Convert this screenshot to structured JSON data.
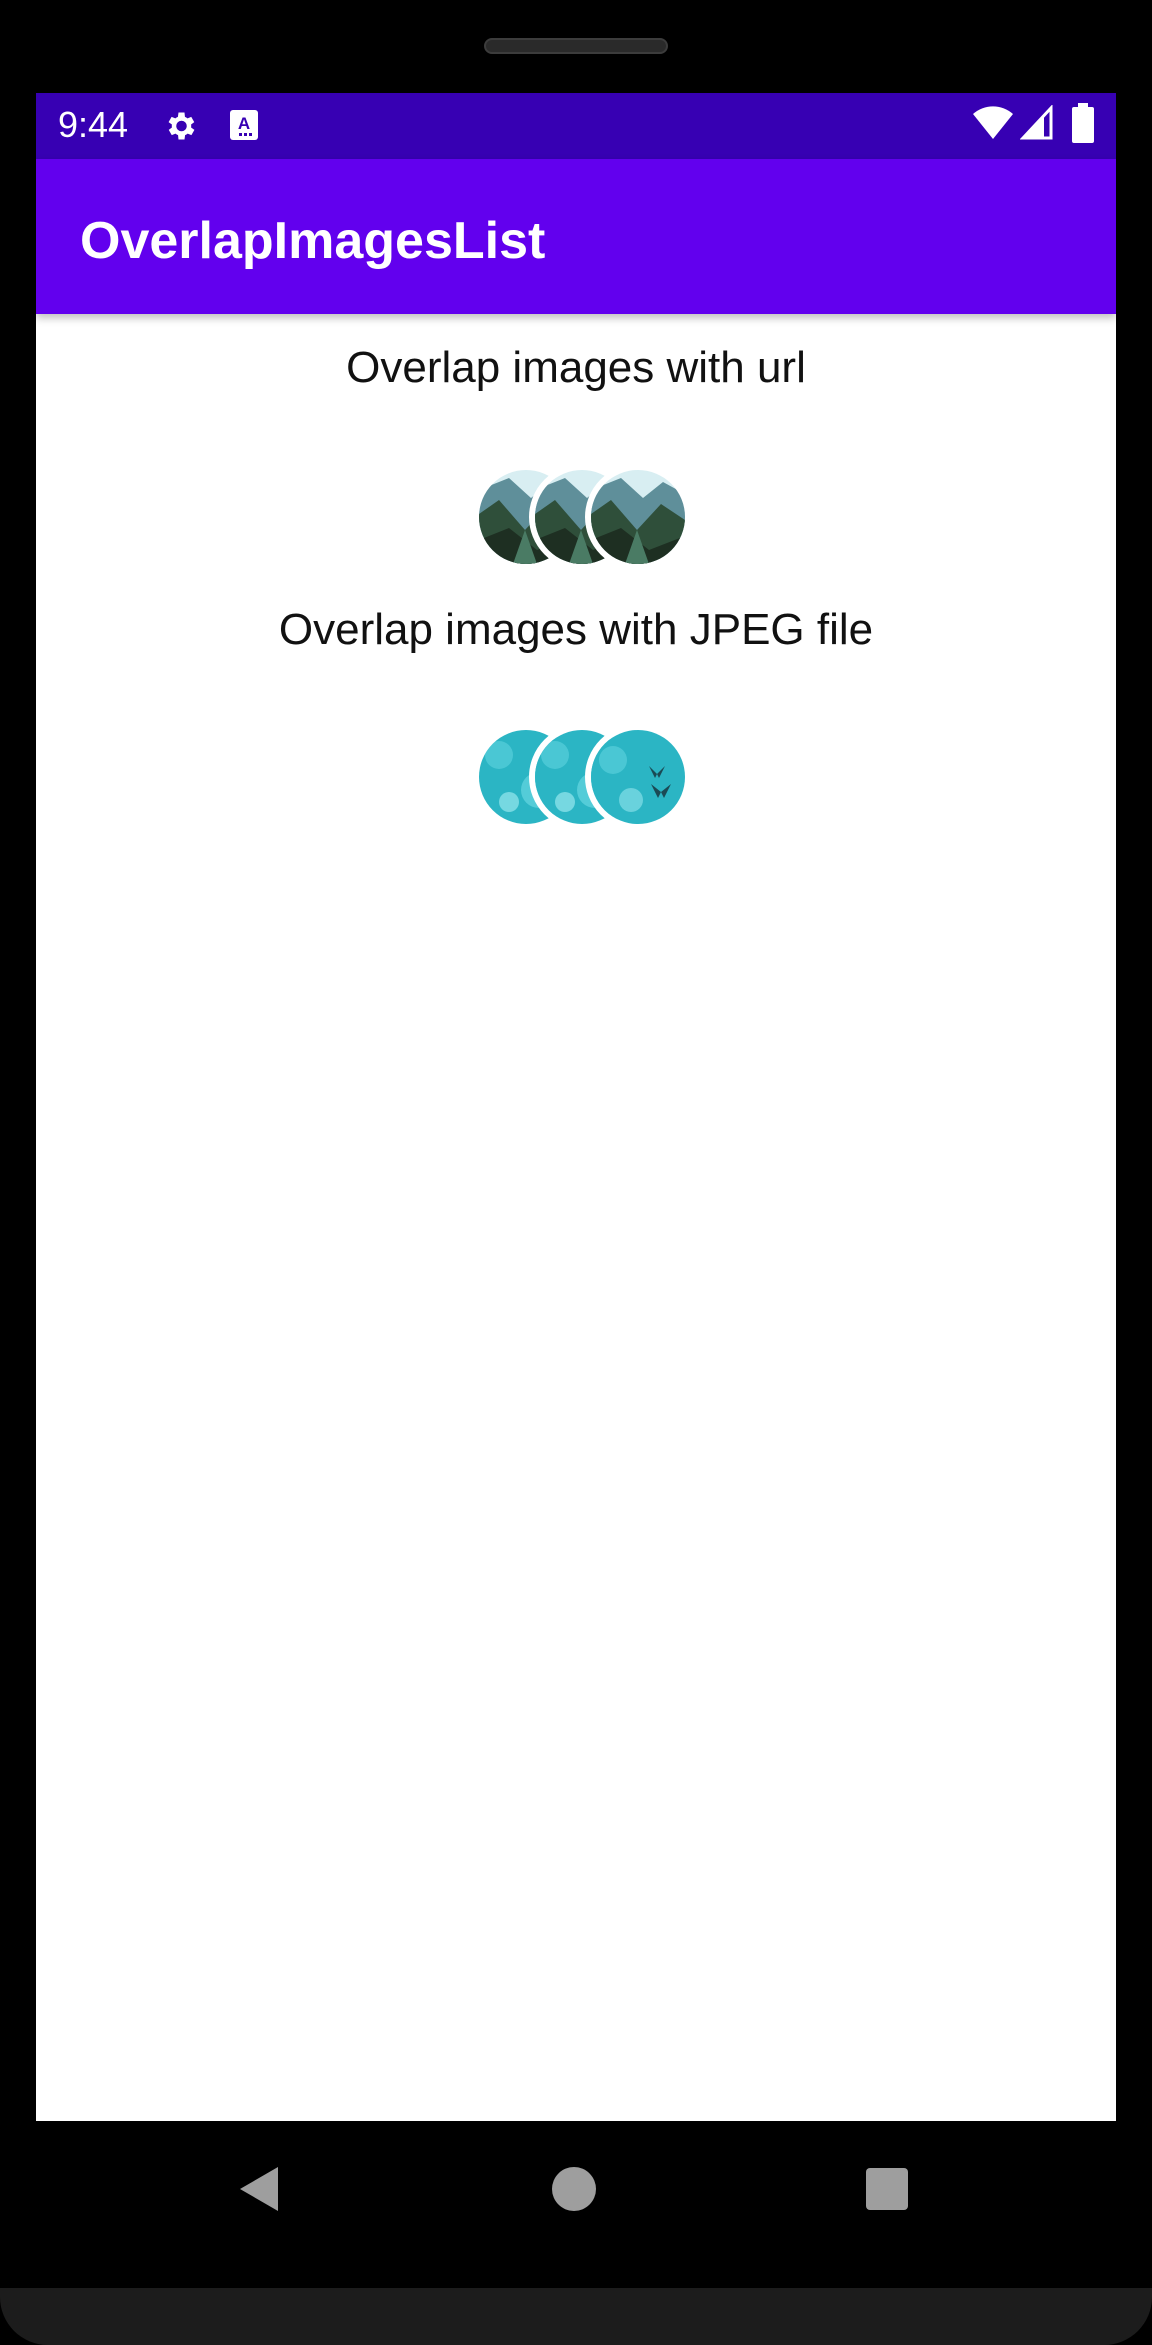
{
  "status_bar": {
    "time": "9:44",
    "icons": [
      "gear-icon",
      "keyboard-a-icon",
      "wifi-icon",
      "signal-icon",
      "battery-icon"
    ],
    "background_color": "#3700b3"
  },
  "app_bar": {
    "title": "OverlapImagesList",
    "background_color": "#6200ee"
  },
  "sections": [
    {
      "title": "Overlap images with url",
      "images": [
        "mountain-valley-image",
        "mountain-valley-image",
        "mountain-valley-image"
      ]
    },
    {
      "title": "Overlap images with JPEG file",
      "images": [
        "teal-bokeh-image",
        "teal-bokeh-image",
        "teal-butterfly-image"
      ]
    }
  ],
  "nav_bar": {
    "icons": [
      "back-icon",
      "home-icon",
      "recents-icon"
    ]
  }
}
